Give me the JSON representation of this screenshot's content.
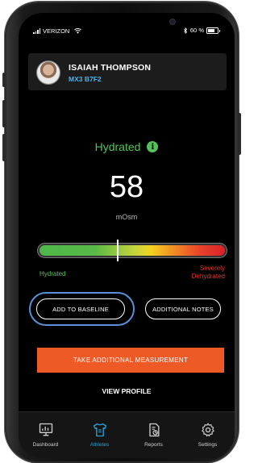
{
  "status_bar": {
    "carrier": "VERIZON",
    "battery": "60 %"
  },
  "athlete": {
    "name": "ISAIAH THOMPSON",
    "device_id": "MX3 B7F2"
  },
  "hydration": {
    "status": "Hydrated",
    "reading": "58",
    "unit": "mOsm",
    "gauge_level": 0.42,
    "gauge_low_label": "Hydrated",
    "gauge_high_label_1": "Severely",
    "gauge_high_label_2": "Dehydrated"
  },
  "actions": {
    "add_baseline": "ADD TO BASELINE",
    "additional_notes": "ADDITIONAL NOTES",
    "take_measurement": "TAKE ADDITIONAL MEASUREMENT",
    "view_profile": "VIEW PROFILE"
  },
  "tabs": [
    {
      "label": "Dashboard",
      "icon": "dashboard-icon"
    },
    {
      "label": "Athletes",
      "icon": "athletes-shirt-icon",
      "active": true
    },
    {
      "label": "Reports",
      "icon": "reports-icon"
    },
    {
      "label": "Settings",
      "icon": "settings-gear-icon"
    }
  ],
  "colors": {
    "accent_blue": "#2aa3d8",
    "hydrated_green": "#54c25a",
    "dehydrated_red": "#e2342c",
    "cta_orange": "#ee5a26",
    "highlight_ring": "#5b8fd6"
  }
}
